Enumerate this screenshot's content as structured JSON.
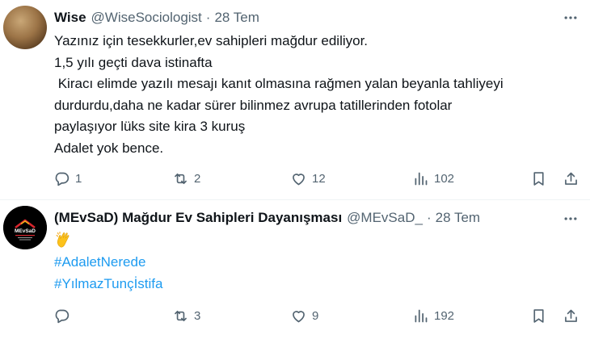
{
  "tweets": [
    {
      "name": "Wise",
      "handle": "@WiseSociologist",
      "dot": "·",
      "time": "28 Tem",
      "lines": [
        "Yazınız için tesekkurler,ev sahipleri mağdur ediliyor.",
        "1,5 yılı geçti dava istinafta",
        " Kiracı elimde yazılı mesajı kanıt olmasına rağmen yalan beyanla tahliyeyi",
        "durdurdu,daha ne kadar sürer bilinmez avrupa tatillerinden fotolar",
        "paylaşıyor lüks site kira 3 kuruş",
        "Adalet yok bence."
      ],
      "replies": "1",
      "retweets": "2",
      "likes": "12",
      "views": "102"
    },
    {
      "name": "(MEvSaD) Mağdur Ev Sahipleri Dayanışması",
      "handle": "@MEvSaD_",
      "dot": "·",
      "time": "28 Tem",
      "avatar_text": "MEvSaD",
      "emoji": "👏",
      "hashtags": [
        "#AdaletNerede",
        "#YılmazTunçİstifa"
      ],
      "replies": "",
      "retweets": "3",
      "likes": "9",
      "views": "192"
    }
  ],
  "colors": {
    "text": "#0f1419",
    "secondary": "#536471",
    "link": "#1d9bf0",
    "divider": "#eff3f4"
  },
  "icons": [
    "more-icon",
    "reply-icon",
    "retweet-icon",
    "like-icon",
    "views-icon",
    "bookmark-icon",
    "share-icon"
  ]
}
